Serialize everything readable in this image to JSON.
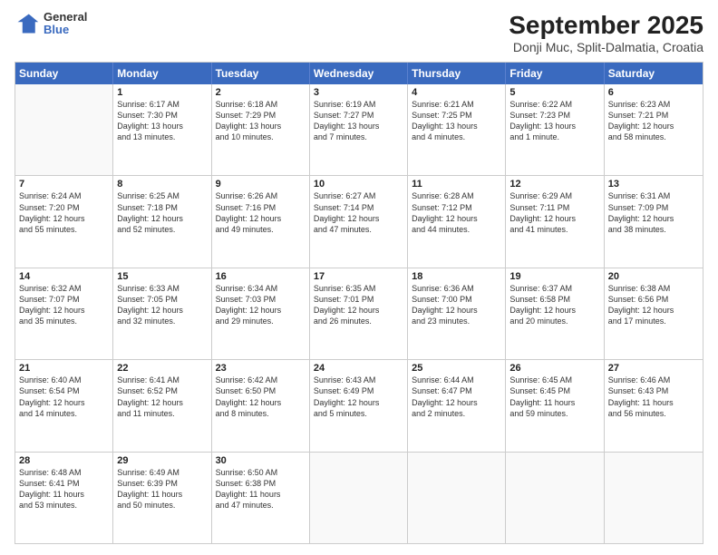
{
  "header": {
    "logo_line1": "General",
    "logo_line2": "Blue",
    "title": "September 2025",
    "subtitle": "Donji Muc, Split-Dalmatia, Croatia"
  },
  "weekdays": [
    "Sunday",
    "Monday",
    "Tuesday",
    "Wednesday",
    "Thursday",
    "Friday",
    "Saturday"
  ],
  "weeks": [
    [
      {
        "day": "",
        "lines": []
      },
      {
        "day": "1",
        "lines": [
          "Sunrise: 6:17 AM",
          "Sunset: 7:30 PM",
          "Daylight: 13 hours",
          "and 13 minutes."
        ]
      },
      {
        "day": "2",
        "lines": [
          "Sunrise: 6:18 AM",
          "Sunset: 7:29 PM",
          "Daylight: 13 hours",
          "and 10 minutes."
        ]
      },
      {
        "day": "3",
        "lines": [
          "Sunrise: 6:19 AM",
          "Sunset: 7:27 PM",
          "Daylight: 13 hours",
          "and 7 minutes."
        ]
      },
      {
        "day": "4",
        "lines": [
          "Sunrise: 6:21 AM",
          "Sunset: 7:25 PM",
          "Daylight: 13 hours",
          "and 4 minutes."
        ]
      },
      {
        "day": "5",
        "lines": [
          "Sunrise: 6:22 AM",
          "Sunset: 7:23 PM",
          "Daylight: 13 hours",
          "and 1 minute."
        ]
      },
      {
        "day": "6",
        "lines": [
          "Sunrise: 6:23 AM",
          "Sunset: 7:21 PM",
          "Daylight: 12 hours",
          "and 58 minutes."
        ]
      }
    ],
    [
      {
        "day": "7",
        "lines": [
          "Sunrise: 6:24 AM",
          "Sunset: 7:20 PM",
          "Daylight: 12 hours",
          "and 55 minutes."
        ]
      },
      {
        "day": "8",
        "lines": [
          "Sunrise: 6:25 AM",
          "Sunset: 7:18 PM",
          "Daylight: 12 hours",
          "and 52 minutes."
        ]
      },
      {
        "day": "9",
        "lines": [
          "Sunrise: 6:26 AM",
          "Sunset: 7:16 PM",
          "Daylight: 12 hours",
          "and 49 minutes."
        ]
      },
      {
        "day": "10",
        "lines": [
          "Sunrise: 6:27 AM",
          "Sunset: 7:14 PM",
          "Daylight: 12 hours",
          "and 47 minutes."
        ]
      },
      {
        "day": "11",
        "lines": [
          "Sunrise: 6:28 AM",
          "Sunset: 7:12 PM",
          "Daylight: 12 hours",
          "and 44 minutes."
        ]
      },
      {
        "day": "12",
        "lines": [
          "Sunrise: 6:29 AM",
          "Sunset: 7:11 PM",
          "Daylight: 12 hours",
          "and 41 minutes."
        ]
      },
      {
        "day": "13",
        "lines": [
          "Sunrise: 6:31 AM",
          "Sunset: 7:09 PM",
          "Daylight: 12 hours",
          "and 38 minutes."
        ]
      }
    ],
    [
      {
        "day": "14",
        "lines": [
          "Sunrise: 6:32 AM",
          "Sunset: 7:07 PM",
          "Daylight: 12 hours",
          "and 35 minutes."
        ]
      },
      {
        "day": "15",
        "lines": [
          "Sunrise: 6:33 AM",
          "Sunset: 7:05 PM",
          "Daylight: 12 hours",
          "and 32 minutes."
        ]
      },
      {
        "day": "16",
        "lines": [
          "Sunrise: 6:34 AM",
          "Sunset: 7:03 PM",
          "Daylight: 12 hours",
          "and 29 minutes."
        ]
      },
      {
        "day": "17",
        "lines": [
          "Sunrise: 6:35 AM",
          "Sunset: 7:01 PM",
          "Daylight: 12 hours",
          "and 26 minutes."
        ]
      },
      {
        "day": "18",
        "lines": [
          "Sunrise: 6:36 AM",
          "Sunset: 7:00 PM",
          "Daylight: 12 hours",
          "and 23 minutes."
        ]
      },
      {
        "day": "19",
        "lines": [
          "Sunrise: 6:37 AM",
          "Sunset: 6:58 PM",
          "Daylight: 12 hours",
          "and 20 minutes."
        ]
      },
      {
        "day": "20",
        "lines": [
          "Sunrise: 6:38 AM",
          "Sunset: 6:56 PM",
          "Daylight: 12 hours",
          "and 17 minutes."
        ]
      }
    ],
    [
      {
        "day": "21",
        "lines": [
          "Sunrise: 6:40 AM",
          "Sunset: 6:54 PM",
          "Daylight: 12 hours",
          "and 14 minutes."
        ]
      },
      {
        "day": "22",
        "lines": [
          "Sunrise: 6:41 AM",
          "Sunset: 6:52 PM",
          "Daylight: 12 hours",
          "and 11 minutes."
        ]
      },
      {
        "day": "23",
        "lines": [
          "Sunrise: 6:42 AM",
          "Sunset: 6:50 PM",
          "Daylight: 12 hours",
          "and 8 minutes."
        ]
      },
      {
        "day": "24",
        "lines": [
          "Sunrise: 6:43 AM",
          "Sunset: 6:49 PM",
          "Daylight: 12 hours",
          "and 5 minutes."
        ]
      },
      {
        "day": "25",
        "lines": [
          "Sunrise: 6:44 AM",
          "Sunset: 6:47 PM",
          "Daylight: 12 hours",
          "and 2 minutes."
        ]
      },
      {
        "day": "26",
        "lines": [
          "Sunrise: 6:45 AM",
          "Sunset: 6:45 PM",
          "Daylight: 11 hours",
          "and 59 minutes."
        ]
      },
      {
        "day": "27",
        "lines": [
          "Sunrise: 6:46 AM",
          "Sunset: 6:43 PM",
          "Daylight: 11 hours",
          "and 56 minutes."
        ]
      }
    ],
    [
      {
        "day": "28",
        "lines": [
          "Sunrise: 6:48 AM",
          "Sunset: 6:41 PM",
          "Daylight: 11 hours",
          "and 53 minutes."
        ]
      },
      {
        "day": "29",
        "lines": [
          "Sunrise: 6:49 AM",
          "Sunset: 6:39 PM",
          "Daylight: 11 hours",
          "and 50 minutes."
        ]
      },
      {
        "day": "30",
        "lines": [
          "Sunrise: 6:50 AM",
          "Sunset: 6:38 PM",
          "Daylight: 11 hours",
          "and 47 minutes."
        ]
      },
      {
        "day": "",
        "lines": []
      },
      {
        "day": "",
        "lines": []
      },
      {
        "day": "",
        "lines": []
      },
      {
        "day": "",
        "lines": []
      }
    ]
  ]
}
